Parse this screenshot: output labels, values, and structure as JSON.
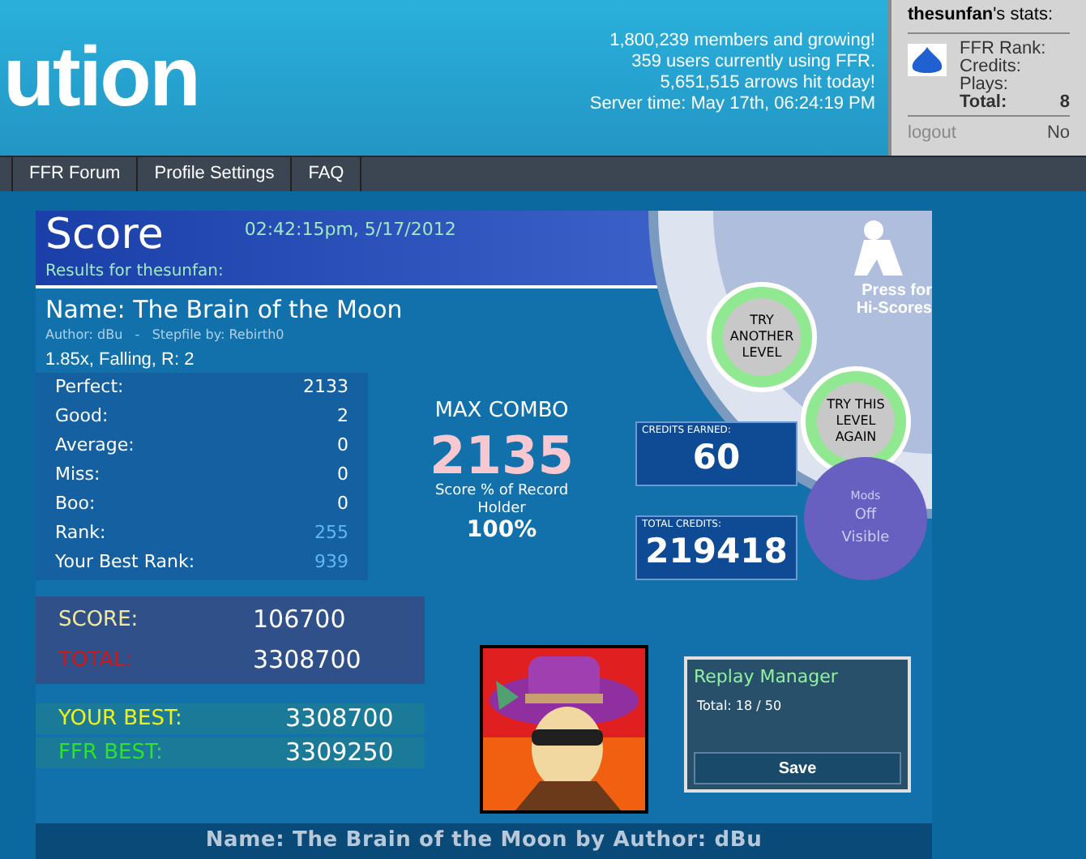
{
  "header": {
    "logo_text": "ution",
    "site_stats": [
      "1,800,239 members and growing!",
      "359 users currently using FFR.",
      "5,651,515 arrows hit today!",
      "Server time: May 17th, 06:24:19 PM"
    ]
  },
  "user_panel": {
    "username": "thesunfan",
    "title_suffix": "'s stats:",
    "fields": [
      {
        "label": "FFR Rank:",
        "bold": false
      },
      {
        "label": "Credits:",
        "bold": false
      },
      {
        "label": "Plays:",
        "bold": false
      },
      {
        "label": "Total:",
        "bold": true,
        "value": "8"
      }
    ],
    "logout": "logout",
    "status": "No"
  },
  "nav": {
    "items": [
      "FFR Forum",
      "Profile Settings",
      "FAQ"
    ]
  },
  "game": {
    "title": "Score",
    "timestamp": "02:42:15pm, 5/17/2012",
    "results_for": "Results for thesunfan:",
    "song_name": "Name: The Brain of the Moon",
    "author_line": "Author: dBu   -   Stepfile by: Rebirth0",
    "settings": "1.85x, Falling, R: 2",
    "judgements": [
      {
        "label": "Perfect:",
        "value": "2133",
        "kind": "count"
      },
      {
        "label": "Good:",
        "value": "2",
        "kind": "count"
      },
      {
        "label": "Average:",
        "value": "0",
        "kind": "count"
      },
      {
        "label": "Miss:",
        "value": "0",
        "kind": "count"
      },
      {
        "label": "Boo:",
        "value": "0",
        "kind": "count"
      },
      {
        "label": "Rank:",
        "value": "255",
        "kind": "rank"
      },
      {
        "label": "Your Best Rank:",
        "value": "939",
        "kind": "rank"
      }
    ],
    "max_combo": {
      "label": "MAX COMBO",
      "value": "2135",
      "pct_label": "Score % of Record Holder",
      "pct_value": "100%"
    },
    "menu_buttons": [
      "TRY ANOTHER LEVEL",
      "TRY THIS LEVEL AGAIN"
    ],
    "hiscores": "Press for Hi-Scores",
    "credits": [
      {
        "label": "CREDITS EARNED:",
        "value": "60"
      },
      {
        "label": "TOTAL CREDITS:",
        "value": "219418"
      }
    ],
    "mods": {
      "label": "Mods",
      "values": [
        "Off",
        "Visible"
      ]
    },
    "scores": [
      {
        "label": "SCORE:",
        "value": "106700",
        "color": "#f0e8a0"
      },
      {
        "label": "TOTAL:",
        "value": "3308700",
        "color": "#d01818"
      }
    ],
    "bests": [
      {
        "label": "YOUR BEST:",
        "value": "3308700",
        "color": "#f0f020"
      },
      {
        "label": "FFR BEST:",
        "value": "3309250",
        "color": "#30e030"
      }
    ],
    "replay": {
      "title": "Replay Manager",
      "total": "Total: 18 / 50",
      "save": "Save"
    },
    "footer": "Name: The Brain of the Moon by Author: dBu"
  }
}
